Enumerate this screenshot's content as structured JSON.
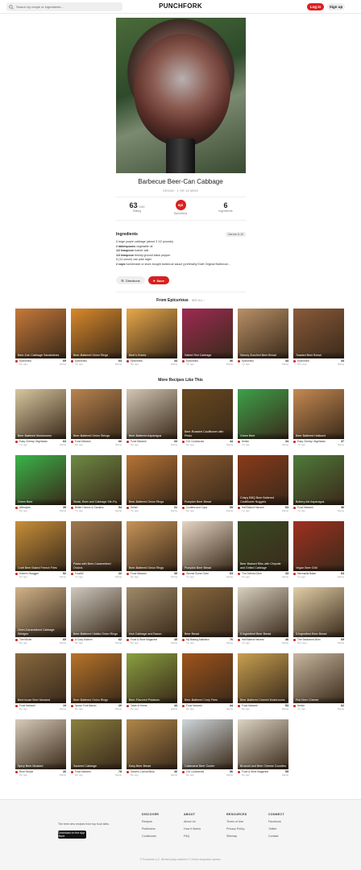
{
  "header": {
    "search_placeholder": "Search by recipe or ingredients...",
    "logo": "PUNCHFORK",
    "login": "Log in",
    "signup": "Sign up"
  },
  "recipe": {
    "title": "Barbecue Beer-Can Cabbage",
    "subtitle": "VEGAN · 1 HR 15 MINS",
    "rating_value": "63",
    "rating_suffix": "/ 100",
    "rating_label": "Rating",
    "source_logo": "epi",
    "source_label": "Epicurious",
    "ingredients_count": "6",
    "ingredients_label": "Ingredients"
  },
  "ingredients": {
    "heading": "Ingredients",
    "serves": "Serves 6-10",
    "items": [
      {
        "qty": "1",
        "text": " large purple cabbage (about 3 1/2 pounds)"
      },
      {
        "qty": "2 tablespoons",
        "text": " vegetable oil"
      },
      {
        "qty": "1/2 teaspoon",
        "text": " kosher salt"
      },
      {
        "qty": "1/4 teaspoon",
        "text": " freshly ground black pepper"
      },
      {
        "qty": "1",
        "text": " (12-ounce) can pale lager"
      },
      {
        "qty": "2 cups",
        "text": " homemade or store-bought barbecue sauce (preferably Kraft Original Barbecue..."
      }
    ],
    "directions_btn": "Directions",
    "save_btn": "Save"
  },
  "from_section": {
    "title": "From Epicurious",
    "see_all": "SEE ALL ›"
  },
  "more_section": {
    "title": "More Recipes Like This"
  },
  "from_cards": [
    {
      "title": "Beer-Can Cabbage Sandwiches",
      "source": "Epicurious",
      "ago": "8yr ago",
      "rating": "69",
      "color": "#c7793a"
    },
    {
      "title": "Beer-Battered Onion Rings",
      "source": "Epicurious",
      "ago": "7yr ago",
      "rating": "63",
      "color": "#d9892b"
    },
    {
      "title": "Beer's Knees",
      "source": "Epicurious",
      "ago": "8yr ago",
      "rating": "44",
      "color": "#e8a84a"
    },
    {
      "title": "Salted Red Cabbage",
      "source": "Epicurious",
      "ago": "7yr ago",
      "rating": "36",
      "color": "#9e2a53"
    },
    {
      "title": "Savory Zucchini Beer Bread",
      "source": "Epicurious",
      "ago": "7yr ago",
      "rating": "44",
      "color": "#b89067"
    },
    {
      "title": "Toasted Beer Bread",
      "source": "Epicurious",
      "ago": "8mo ago",
      "rating": "44",
      "color": "#8a5a3a"
    }
  ],
  "more_cards": [
    {
      "title": "Beer Battered Mushrooms",
      "source": "Easy Cheesy Vegetarian",
      "ago": "7yr ago",
      "rating": "63",
      "color": "#d8c7a0"
    },
    {
      "title": "Beer-Battered Onion Strings",
      "source": "Food Network",
      "ago": "8yr ago",
      "rating": "66",
      "color": "#b98450"
    },
    {
      "title": "Beer-Battered Asparagus",
      "source": "Food Network",
      "ago": "8yr ago",
      "rating": "33",
      "color": "#d3c7b4"
    },
    {
      "title": "Beer-Roasted Cauliflower with Pesto",
      "source": "101 Cookbooks",
      "ago": "8yr ago",
      "rating": "44",
      "color": "#6a4a20"
    },
    {
      "title": "Green Beer",
      "source": "Delish",
      "ago": "7yr ago",
      "rating": "34",
      "color": "#3da14a"
    },
    {
      "title": "Beer Battered Halloumi",
      "source": "Easy Cheesy Vegetarian",
      "ago": "7yr ago",
      "rating": "37",
      "color": "#c58a52"
    },
    {
      "title": "Green Beer",
      "source": "Allrecipes",
      "ago": "8yr ago",
      "rating": "35",
      "color": "#39b54a"
    },
    {
      "title": "Steak, Beer and Cabbage Stir-Fry",
      "source": "Better Homes & Gardens",
      "ago": "7yr ago",
      "rating": "54",
      "color": "#6e8a44"
    },
    {
      "title": "Beer-Battered Onion Rings",
      "source": "Delish",
      "ago": "7yr ago",
      "rating": "21",
      "color": "#b87436"
    },
    {
      "title": "Pumpkin Beer Bread",
      "source": "Cookies and Cups",
      "ago": "8yr ago",
      "rating": "59",
      "color": "#8a5a30"
    },
    {
      "title": "Crispy BBQ Beer Battered Cauliflower Nuggets",
      "source": "Half Baked Harvest",
      "ago": "7yr ago",
      "rating": "63",
      "color": "#8a3a1a"
    },
    {
      "title": "Buttery Ale Asparagus",
      "source": "Food Network",
      "ago": "7yr ago",
      "rating": "36",
      "color": "#4f7a3a"
    },
    {
      "title": "Craft Beer Baked French Fries",
      "source": "Kitchen Swagger",
      "ago": "6yr ago",
      "rating": "52",
      "color": "#c8903a"
    },
    {
      "title": "Pasta with Beer-Caramelized Onions",
      "source": "Food52",
      "ago": "7yr ago",
      "rating": "22",
      "color": "#a07a50"
    },
    {
      "title": "Beer-Battered Onion Rings",
      "source": "Food Network",
      "ago": "8yr ago",
      "rating": "39",
      "color": "#c89458"
    },
    {
      "title": "Pumpkin Beer Bread",
      "source": "Gimme Some Oven",
      "ago": "7yr ago",
      "rating": "63",
      "color": "#e7d6c4"
    },
    {
      "title": "Beer Braised Ribs with Chipotle and Grilled Cabbage",
      "source": "The Defined Dish",
      "ago": "5yr ago",
      "rating": "33",
      "color": "#3a4a24"
    },
    {
      "title": "Vegan Beer Chili",
      "source": "Minimalist Baker",
      "ago": "7yr ago",
      "rating": "63",
      "color": "#a03020"
    },
    {
      "title": "Oven-Caramelized Cabbage Wedges",
      "source": "The Kitchn",
      "ago": "8yr ago",
      "rating": "69",
      "color": "#d2b48a"
    },
    {
      "title": "Beer-Battered Vidalia Onion Rings",
      "source": "A Cozy Kitchen",
      "ago": "8yr ago",
      "rating": "62",
      "color": "#cfc9bf"
    },
    {
      "title": "Irish Cabbage and Bacon",
      "source": "Food & Wine Magazine",
      "ago": "8yr ago",
      "rating": "45",
      "color": "#a08a6a"
    },
    {
      "title": "Beer Bread",
      "source": "My Baking Addiction",
      "ago": "7yr ago",
      "rating": "76",
      "color": "#8a6a40"
    },
    {
      "title": "5 Ingredient Beer Bread",
      "source": "Half Baked Harvest",
      "ago": "7yr ago",
      "rating": "46",
      "color": "#d8d0c0"
    },
    {
      "title": "3-Ingredient Beer Bread",
      "source": "The Seasoned Mom",
      "ago": "8mo ago",
      "rating": "69",
      "color": "#e2cfa8"
    },
    {
      "title": "Beerhouse Beer Mustard",
      "source": "Food Network",
      "ago": "8yr ago",
      "rating": "19",
      "color": "#8a6a40"
    },
    {
      "title": "Beer Battered Onion Rings",
      "source": "Spoon Fork Bacon",
      "ago": "8yr ago",
      "rating": "20",
      "color": "#b8742a"
    },
    {
      "title": "Beer-Flavored Potatoes",
      "source": "Taste of Home",
      "ago": "8yr ago",
      "rating": "43",
      "color": "#8aa040"
    },
    {
      "title": "Beer-Battered Curly Fries",
      "source": "Food Network",
      "ago": "8yr ago",
      "rating": "44",
      "color": "#a0541c"
    },
    {
      "title": "Beer-Battered Cremini Mushrooms",
      "source": "Food Network",
      "ago": "8yr ago",
      "rating": "53",
      "color": "#c8a050"
    },
    {
      "title": "Pub Beer Cheese",
      "source": "Delish",
      "ago": "7yr ago",
      "rating": "62",
      "color": "#c8b8a0"
    },
    {
      "title": "Spicy Beer Mustard",
      "source": "Real Simple",
      "ago": "8yr ago",
      "rating": "26",
      "color": "#d8cbb8"
    },
    {
      "title": "Sauteed Cabbage",
      "source": "Food Network",
      "ago": "8yr ago",
      "rating": "78",
      "color": "#8a8040"
    },
    {
      "title": "Easy Beer Bread",
      "source": "Sarah's Cucina Bella",
      "ago": "8yr ago",
      "rating": "40",
      "color": "#b0874a"
    },
    {
      "title": "Calamansi Beer Cooler",
      "source": "101 Cookbooks",
      "ago": "8yr ago",
      "rating": "56",
      "color": "#cfd6da"
    },
    {
      "title": "Broccoli and Beer Cheese Cocottes",
      "source": "Food & Wine Magazine",
      "ago": "8yr ago",
      "rating": "55",
      "color": "#ddd4c2"
    }
  ],
  "card_rating_label": "Rating",
  "footer": {
    "tagline": "The best new recipes from top food sites.",
    "appstore": "Download on the App Store",
    "discover": {
      "heading": "DISCOVER",
      "links": [
        "Recipes",
        "Publishers",
        "Cookbooks"
      ]
    },
    "about": {
      "heading": "ABOUT",
      "links": [
        "About Us",
        "How it Works",
        "FAQ"
      ]
    },
    "resources": {
      "heading": "RESOURCES",
      "links": [
        "Terms of Use",
        "Privacy Policy",
        "Sitemap"
      ]
    },
    "connect": {
      "heading": "CONNECT",
      "links": [
        "Facebook",
        "Twitter",
        "Contact"
      ]
    },
    "copyright": "© Punchfork LLC. All third party content is © of their respective owners."
  }
}
